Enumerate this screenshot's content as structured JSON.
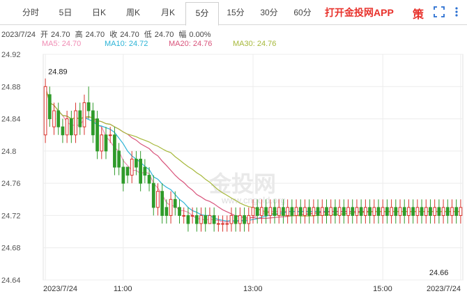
{
  "tabs": [
    "分时",
    "5日",
    "日K",
    "周K",
    "月K",
    "5分",
    "15分",
    "30分",
    "60分"
  ],
  "active_tab": "5分",
  "brand_text": "打开金投网APP",
  "strategy_label": "策",
  "quote": {
    "date": "2023/7/24",
    "open_label": "开",
    "open": "24.70",
    "high_label": "高",
    "high": "24.70",
    "close_label": "收",
    "close": "24.70",
    "low_label": "低",
    "low": "24.70",
    "change_label": "幅",
    "change": "0.00%"
  },
  "ma_legend": [
    {
      "label": "MA5: 24.70",
      "color": "#f08cb4"
    },
    {
      "label": "MA10: 24.72",
      "color": "#2ab3d6"
    },
    {
      "label": "MA20: 24.76",
      "color": "#d8527a"
    },
    {
      "label": "MA30: 24.76",
      "color": "#a6b83a"
    }
  ],
  "watermark": {
    "cn": "金投网",
    "url": "www.cngold.org"
  },
  "colors": {
    "up": "#d9332c",
    "down": "#2f9b2a",
    "brand": "#e8312b"
  },
  "chart_data": {
    "type": "candlestick",
    "ylim": [
      24.64,
      24.92
    ],
    "yticks": [
      24.92,
      24.88,
      24.84,
      24.8,
      24.76,
      24.72,
      24.68,
      24.64
    ],
    "ytick_labels": [
      "24.92",
      "24.88",
      "24.84",
      "24.8",
      "24.76",
      "24.72",
      "24.68",
      "24.64"
    ],
    "xticks": [
      {
        "label": "2023/7/24",
        "index": 0
      },
      {
        "label": "11:00",
        "index": 18
      },
      {
        "label": "13:00",
        "index": 48
      },
      {
        "label": "15:00",
        "index": 78
      },
      {
        "label": "2023/7/24",
        "index": 96
      }
    ],
    "annotations": [
      {
        "text": "24.89",
        "index": 0,
        "value": 24.89
      },
      {
        "text": "24.66",
        "index": 91,
        "value": 24.66
      }
    ],
    "candles": [
      [
        24.82,
        24.88,
        24.89,
        24.81
      ],
      [
        24.87,
        24.84,
        24.88,
        24.83
      ],
      [
        24.83,
        24.85,
        24.86,
        24.82
      ],
      [
        24.85,
        24.83,
        24.86,
        24.82
      ],
      [
        24.83,
        24.82,
        24.84,
        24.81
      ],
      [
        24.82,
        24.84,
        24.85,
        24.81
      ],
      [
        24.84,
        24.82,
        24.85,
        24.81
      ],
      [
        24.82,
        24.85,
        24.86,
        24.81
      ],
      [
        24.85,
        24.83,
        24.86,
        24.82
      ],
      [
        24.83,
        24.86,
        24.87,
        24.82
      ],
      [
        24.86,
        24.85,
        24.88,
        24.84
      ],
      [
        24.85,
        24.82,
        24.86,
        24.81
      ],
      [
        24.84,
        24.8,
        24.85,
        24.79
      ],
      [
        24.8,
        24.82,
        24.83,
        24.79
      ],
      [
        24.82,
        24.8,
        24.83,
        24.79
      ],
      [
        24.82,
        24.82,
        24.83,
        24.81
      ],
      [
        24.82,
        24.78,
        24.83,
        24.77
      ],
      [
        24.8,
        24.78,
        24.81,
        24.77
      ],
      [
        24.78,
        24.76,
        24.79,
        24.75
      ],
      [
        24.78,
        24.77,
        24.78,
        24.76
      ],
      [
        24.77,
        24.79,
        24.8,
        24.76
      ],
      [
        24.79,
        24.78,
        24.8,
        24.77
      ],
      [
        24.79,
        24.76,
        24.8,
        24.75
      ],
      [
        24.78,
        24.77,
        24.79,
        24.76
      ],
      [
        24.77,
        24.76,
        24.78,
        24.75
      ],
      [
        24.76,
        24.73,
        24.77,
        24.72
      ],
      [
        24.73,
        24.75,
        24.76,
        24.72
      ],
      [
        24.75,
        24.72,
        24.76,
        24.71
      ],
      [
        24.73,
        24.72,
        24.74,
        24.71
      ],
      [
        24.72,
        24.74,
        24.75,
        24.71
      ],
      [
        24.74,
        24.73,
        24.75,
        24.72
      ],
      [
        24.73,
        24.72,
        24.74,
        24.71
      ],
      [
        24.72,
        24.72,
        24.73,
        24.71
      ],
      [
        24.72,
        24.71,
        24.73,
        24.7
      ],
      [
        24.72,
        24.72,
        24.73,
        24.71
      ],
      [
        24.72,
        24.71,
        24.73,
        24.7
      ],
      [
        24.71,
        24.72,
        24.73,
        24.7
      ],
      [
        24.72,
        24.71,
        24.73,
        24.7
      ],
      [
        24.71,
        24.72,
        24.73,
        24.71
      ],
      [
        24.72,
        24.71,
        24.73,
        24.7
      ],
      [
        24.71,
        24.71,
        24.72,
        24.7
      ],
      [
        24.71,
        24.71,
        24.72,
        24.7
      ],
      [
        24.71,
        24.71,
        24.72,
        24.7
      ],
      [
        24.71,
        24.72,
        24.73,
        24.7
      ],
      [
        24.72,
        24.71,
        24.73,
        24.7
      ],
      [
        24.71,
        24.72,
        24.73,
        24.7
      ],
      [
        24.72,
        24.71,
        24.73,
        24.7
      ],
      [
        24.71,
        24.72,
        24.73,
        24.7
      ],
      [
        24.72,
        24.73,
        24.74,
        24.71
      ],
      [
        24.73,
        24.72,
        24.74,
        24.71
      ],
      [
        24.72,
        24.73,
        24.74,
        24.71
      ],
      [
        24.73,
        24.72,
        24.74,
        24.71
      ],
      [
        24.72,
        24.73,
        24.74,
        24.71
      ],
      [
        24.73,
        24.72,
        24.74,
        24.71
      ],
      [
        24.72,
        24.73,
        24.74,
        24.71
      ],
      [
        24.73,
        24.72,
        24.74,
        24.71
      ],
      [
        24.72,
        24.73,
        24.74,
        24.71
      ],
      [
        24.73,
        24.72,
        24.74,
        24.71
      ],
      [
        24.72,
        24.73,
        24.74,
        24.71
      ],
      [
        24.73,
        24.72,
        24.74,
        24.71
      ],
      [
        24.72,
        24.73,
        24.74,
        24.71
      ],
      [
        24.73,
        24.72,
        24.74,
        24.71
      ],
      [
        24.72,
        24.73,
        24.74,
        24.71
      ],
      [
        24.73,
        24.72,
        24.74,
        24.71
      ],
      [
        24.72,
        24.73,
        24.74,
        24.71
      ],
      [
        24.73,
        24.72,
        24.74,
        24.71
      ],
      [
        24.72,
        24.73,
        24.74,
        24.71
      ],
      [
        24.73,
        24.72,
        24.74,
        24.71
      ],
      [
        24.72,
        24.73,
        24.74,
        24.71
      ],
      [
        24.73,
        24.72,
        24.74,
        24.71
      ],
      [
        24.72,
        24.73,
        24.74,
        24.71
      ],
      [
        24.73,
        24.72,
        24.74,
        24.71
      ],
      [
        24.72,
        24.73,
        24.74,
        24.71
      ],
      [
        24.73,
        24.72,
        24.74,
        24.71
      ],
      [
        24.72,
        24.73,
        24.74,
        24.71
      ],
      [
        24.73,
        24.72,
        24.74,
        24.71
      ],
      [
        24.72,
        24.73,
        24.74,
        24.71
      ],
      [
        24.73,
        24.72,
        24.74,
        24.71
      ],
      [
        24.72,
        24.73,
        24.74,
        24.71
      ],
      [
        24.73,
        24.72,
        24.74,
        24.71
      ],
      [
        24.72,
        24.73,
        24.74,
        24.71
      ],
      [
        24.73,
        24.72,
        24.74,
        24.71
      ],
      [
        24.72,
        24.73,
        24.74,
        24.71
      ],
      [
        24.73,
        24.72,
        24.74,
        24.71
      ],
      [
        24.72,
        24.73,
        24.74,
        24.71
      ],
      [
        24.73,
        24.72,
        24.74,
        24.71
      ],
      [
        24.72,
        24.73,
        24.74,
        24.71
      ],
      [
        24.73,
        24.72,
        24.74,
        24.71
      ],
      [
        24.72,
        24.73,
        24.74,
        24.71
      ],
      [
        24.73,
        24.72,
        24.74,
        24.71
      ],
      [
        24.72,
        24.73,
        24.74,
        24.71
      ],
      [
        24.73,
        24.72,
        24.74,
        24.71
      ],
      [
        24.72,
        24.73,
        24.74,
        24.71
      ],
      [
        24.73,
        24.72,
        24.74,
        24.71
      ],
      [
        24.72,
        24.73,
        24.74,
        24.71
      ],
      [
        24.73,
        24.72,
        24.74,
        24.71
      ],
      [
        24.72,
        24.73,
        24.74,
        24.71
      ]
    ]
  }
}
